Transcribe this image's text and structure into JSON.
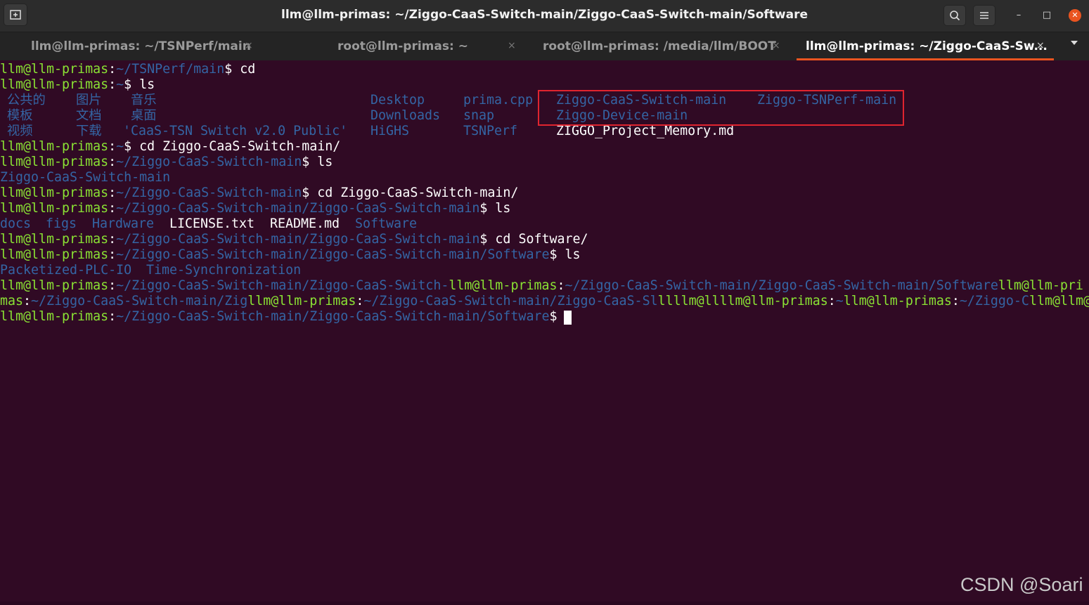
{
  "window": {
    "title": "llm@llm-primas: ~/Ziggo-CaaS-Switch-main/Ziggo-CaaS-Switch-main/Software",
    "search_icon": "search-icon",
    "menu_icon": "hamburger-menu-icon",
    "minimize": "–",
    "maximize": "□",
    "close": "✕"
  },
  "tabs": [
    {
      "label": "llm@llm-primas: ~/TSNPerf/main",
      "close": "×",
      "active": false
    },
    {
      "label": "root@llm-primas: ~",
      "close": "×",
      "active": false
    },
    {
      "label": "root@llm-primas: /media/llm/BOOT",
      "close": "×",
      "active": false
    },
    {
      "label": "llm@llm-primas: ~/Ziggo-CaaS-Sw...",
      "close": "×",
      "active": true
    }
  ],
  "terminal": {
    "line1": {
      "user": "llm@llm-primas",
      "colon": ":",
      "path": "~/TSNPerf/main",
      "prompt": "$ ",
      "cmd": "cd"
    },
    "line2": {
      "user": "llm@llm-primas",
      "colon": ":",
      "path": "~",
      "prompt": "$ ",
      "cmd": "ls"
    },
    "ls_home": {
      "c1": [
        "公共的",
        "模板",
        "视频"
      ],
      "c2": [
        "图片",
        "文档",
        "下载"
      ],
      "c3": [
        "音乐",
        "桌面",
        "'CaaS-TSN Switch v2.0 Public'"
      ],
      "c4": [
        "Desktop",
        "Downloads",
        "HiGHS"
      ],
      "c5": [
        "prima.cpp",
        "snap",
        "TSNPerf"
      ],
      "c6": [
        "Ziggo-CaaS-Switch-main",
        "Ziggo-Device-main",
        "ZIGGO_Project_Memory.md"
      ],
      "c7": [
        "Ziggo-TSNPerf-main"
      ]
    },
    "line6": {
      "user": "llm@llm-primas",
      "colon": ":",
      "path": "~",
      "prompt": "$ ",
      "cmd": "cd Ziggo-CaaS-Switch-main/"
    },
    "line7": {
      "user": "llm@llm-primas",
      "colon": ":",
      "path": "~/Ziggo-CaaS-Switch-main",
      "prompt": "$ ",
      "cmd": "ls"
    },
    "line8": "Ziggo-CaaS-Switch-main",
    "line9": {
      "user": "llm@llm-primas",
      "colon": ":",
      "path": "~/Ziggo-CaaS-Switch-main",
      "prompt": "$ ",
      "cmd": "cd Ziggo-CaaS-Switch-main/"
    },
    "line10": {
      "user": "llm@llm-primas",
      "colon": ":",
      "path": "~/Ziggo-CaaS-Switch-main/Ziggo-CaaS-Switch-main",
      "prompt": "$ ",
      "cmd": "ls"
    },
    "line11": {
      "docs": "docs",
      "figs": "figs",
      "hardware": "Hardware",
      "license": "LICENSE.txt",
      "readme": "README.md",
      "software": "Software"
    },
    "line12": {
      "user": "llm@llm-primas",
      "colon": ":",
      "path": "~/Ziggo-CaaS-Switch-main/Ziggo-CaaS-Switch-main",
      "prompt": "$ ",
      "cmd": "cd Software/"
    },
    "line13": {
      "user": "llm@llm-primas",
      "colon": ":",
      "path": "~/Ziggo-CaaS-Switch-main/Ziggo-CaaS-Switch-main/Software",
      "prompt": "$ ",
      "cmd": "ls"
    },
    "line14": {
      "plc": "Packetized-PLC-IO",
      "time": "Time-Synchronization"
    },
    "line15": {
      "user1": "llm@llm-primas",
      "colon1": ":",
      "path1": "~/Ziggo-CaaS-Switch-main/Ziggo-CaaS-Switch-",
      "user2": "llm@llm-primas",
      "colon2": ":",
      "path2": "~/Ziggo-CaaS-Switch-main/Ziggo-CaaS-Switch-main/Software",
      "user3": "llm@llm-pri"
    },
    "line16": {
      "p1": "mas",
      "colon1": ":",
      "path1": "~/Ziggo-CaaS-Switch-main/Zig",
      "user2": "llm@llm-primas",
      "colon2": ":",
      "path2": "~/Ziggo-CaaS-Switch-main/Ziggo-CaaS-Sl",
      "user3": "llllm@llllm@llm-primas",
      "colon3": ":",
      "path3": "~",
      "user4": "llm@llm-primas",
      "colon4": ":",
      "path4": "~/Ziggo-C",
      "user5": "llm@llm@"
    },
    "line17": {
      "user": "llm@llm-primas",
      "colon": ":",
      "path": "~/Ziggo-CaaS-Switch-main/Ziggo-CaaS-Switch-main/Software",
      "prompt": "$ "
    }
  },
  "watermark": "CSDN @Soari",
  "colors": {
    "background": "#300a24",
    "user_green": "#8ae234",
    "path_blue": "#3465a4",
    "highlight_red": "#e0242f",
    "accent": "#e95420"
  }
}
